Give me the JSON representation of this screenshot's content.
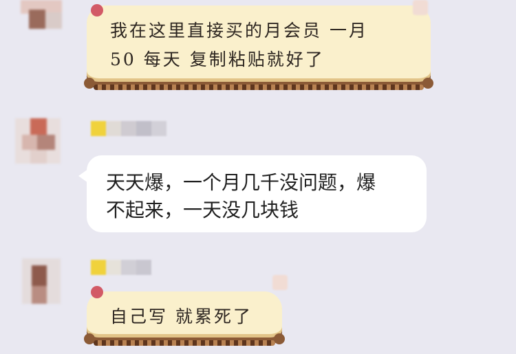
{
  "messages": [
    {
      "sender": "contact",
      "style": "gold-card",
      "lines": [
        "我在这里直接买的月会员 一月",
        "50  每天 复制粘贴就好了"
      ]
    },
    {
      "sender": "contact",
      "style": "plain-white",
      "lines": [
        "天天爆，一个月几千没问题，爆",
        "不起来，一天没几块钱"
      ]
    },
    {
      "sender": "contact",
      "style": "gold-card",
      "lines": [
        "自己写 就累死了"
      ]
    }
  ],
  "colors": {
    "background": "#e9e8f1",
    "gold_bubble": "#faf0cc",
    "gold_trim": "#8b5a36",
    "white_bubble": "#ffffff",
    "accent_pink": "#d25a66"
  },
  "icons": [
    "blurred-avatar",
    "blurred-nickname",
    "bubble-decoration"
  ]
}
